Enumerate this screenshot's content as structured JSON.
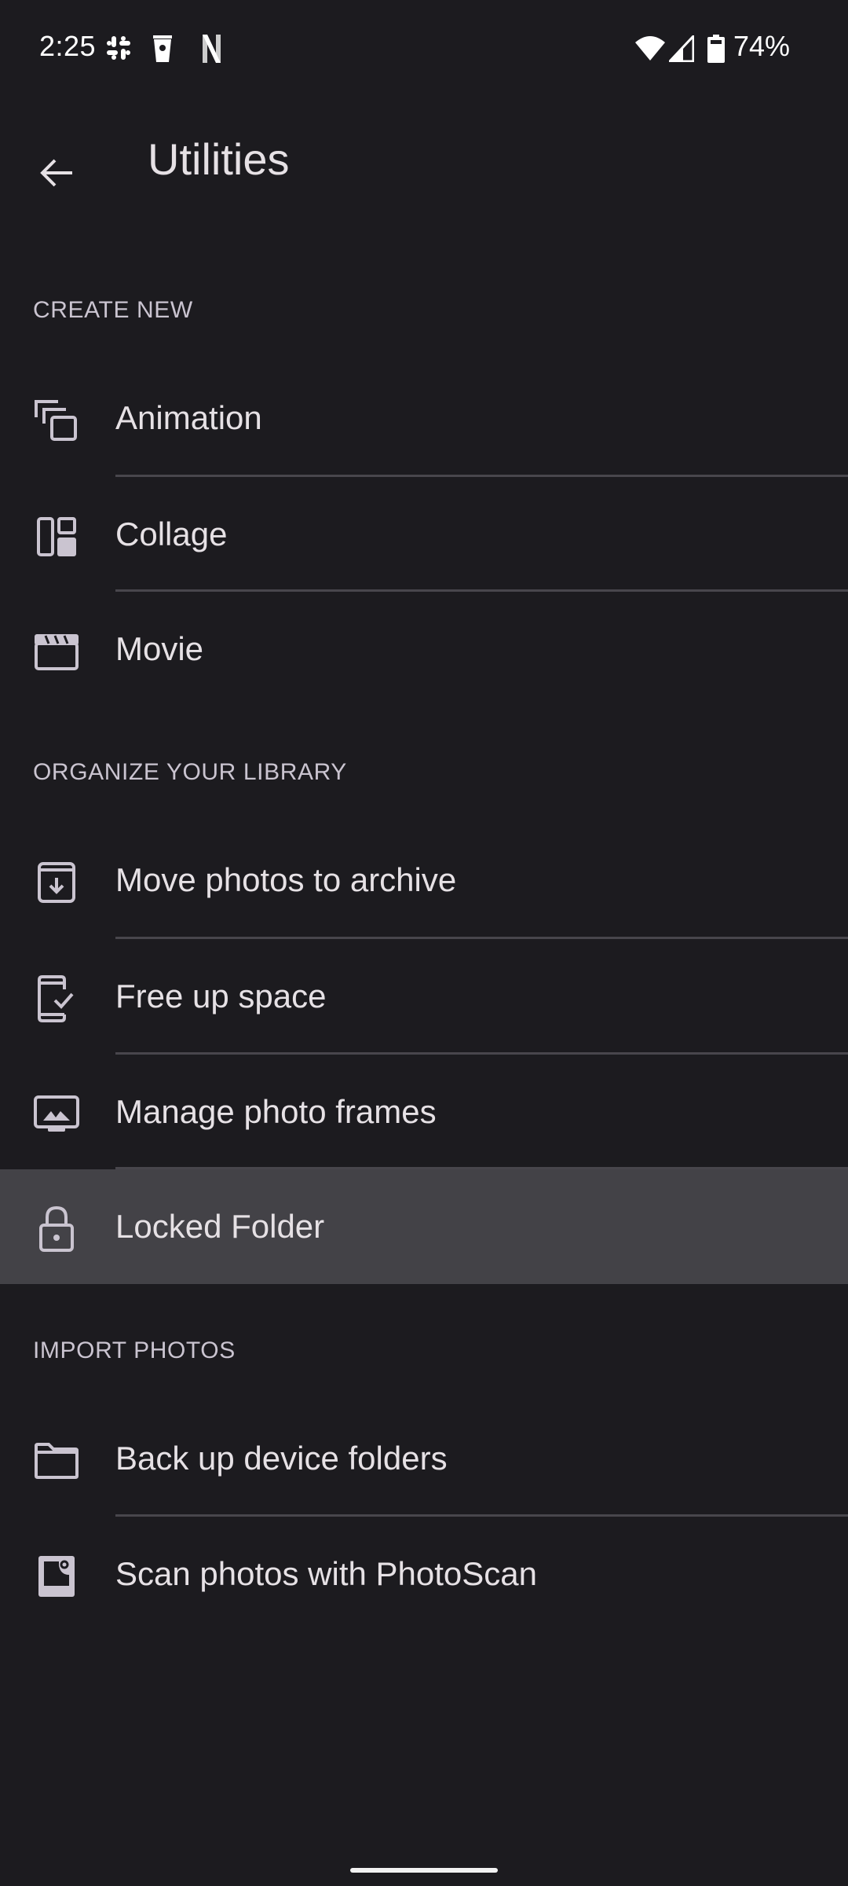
{
  "status_bar": {
    "time": "2:25",
    "notification_icons": [
      "slack-icon",
      "coffee-cup-icon",
      "netflix-icon"
    ],
    "system_icons": [
      "wifi-icon",
      "cell-signal-icon",
      "battery-icon"
    ],
    "battery_percent": "74%"
  },
  "app_bar": {
    "back_icon": "arrow-left-icon",
    "title": "Utilities"
  },
  "sections": [
    {
      "header": "CREATE NEW",
      "items": [
        {
          "label": "Animation",
          "icon": "animation-icon"
        },
        {
          "label": "Collage",
          "icon": "collage-icon"
        },
        {
          "label": "Movie",
          "icon": "movie-icon"
        }
      ]
    },
    {
      "header": "ORGANIZE YOUR LIBRARY",
      "items": [
        {
          "label": "Move photos to archive",
          "icon": "archive-icon"
        },
        {
          "label": "Free up space",
          "icon": "phone-check-icon"
        },
        {
          "label": "Manage photo frames",
          "icon": "photo-frame-icon"
        },
        {
          "label": "Locked Folder",
          "icon": "lock-icon",
          "highlighted": true
        }
      ]
    },
    {
      "header": "IMPORT PHOTOS",
      "items": [
        {
          "label": "Back up device folders",
          "icon": "folder-icon"
        },
        {
          "label": "Scan photos with PhotoScan",
          "icon": "photoscan-icon"
        }
      ]
    }
  ],
  "colors": {
    "background": "#1c1b1f",
    "text_primary": "#e6e1e5",
    "text_secondary": "#cac4d0",
    "divider": "#48464c",
    "highlight": "#434247"
  }
}
